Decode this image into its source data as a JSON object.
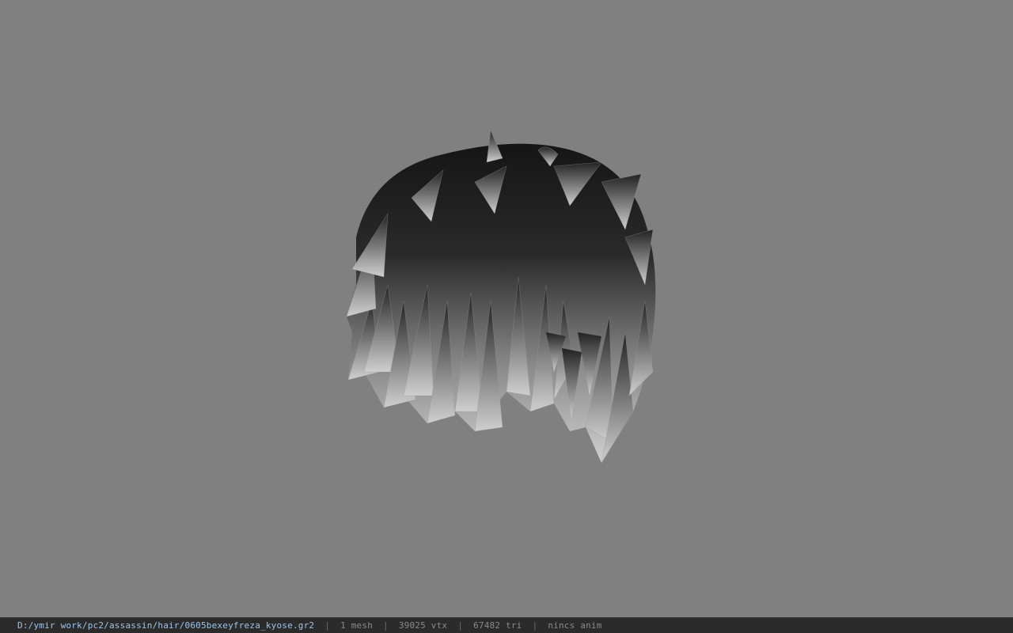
{
  "viewport": {
    "background": "#808080",
    "model_name": "hair-mesh"
  },
  "status": {
    "path": "D:/ymir work/pc2/assassin/hair/0605bexeyfreza_kyose.gr2",
    "separator": "|",
    "mesh": "1 mesh",
    "vtx": "39025 vtx",
    "tri": "67482 tri",
    "anim": "nincs anim"
  },
  "colors": {
    "path_text": "#9fc4e8",
    "stat_text": "#8a8a8a",
    "statusbar_bg": "#2b2b2b",
    "skin": "#8a5a3c",
    "hair_dark": "#1a1a1a",
    "hair_light": "#c8c8c8"
  }
}
